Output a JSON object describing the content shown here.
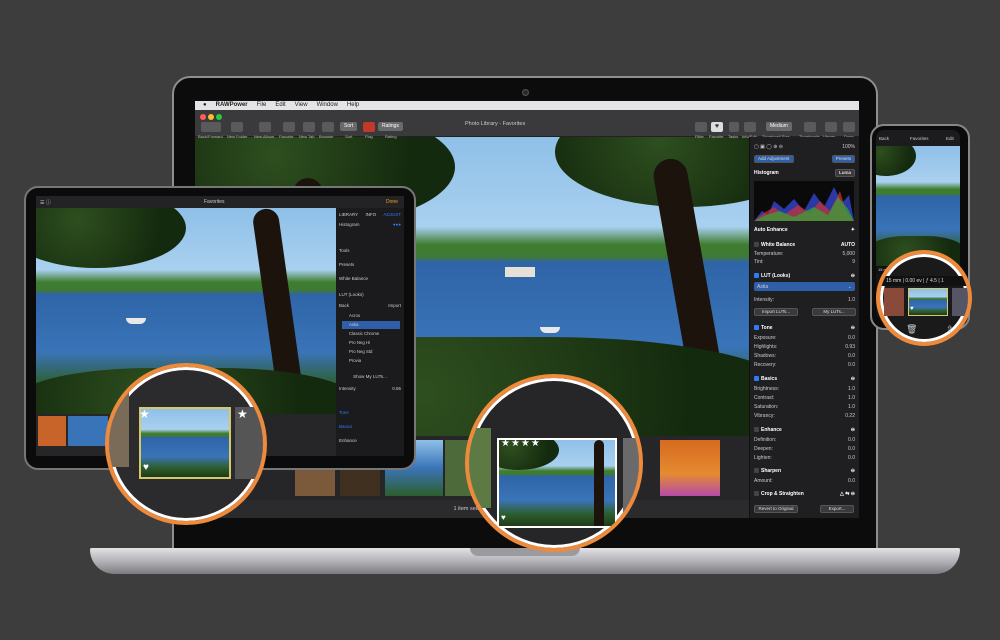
{
  "menu": {
    "apple": "",
    "app": "RAWPower",
    "file": "File",
    "edit": "Edit",
    "view": "View",
    "window": "Window",
    "help": "Help"
  },
  "window_title": "Photo Library - Favorites",
  "toolbar": {
    "back_forward": "Back/Forward",
    "new_folder": "New Folder",
    "new_album": "New Album",
    "favorite": "Favorite",
    "new_tab": "New Tab",
    "browser": "Browser",
    "sort": "Sort",
    "sort_btn": "Sort",
    "flag": "Flag",
    "rating": "Rating",
    "ratings_btn": "Ratings",
    "filter": "Filter",
    "favorite_r": "Favorite",
    "tasks": "Tasks",
    "info_edit": "Info/Edit",
    "thumb_size": "Thumbnail Size",
    "medium": "Medium",
    "thumbnails": "Thumbnails",
    "viewer": "Viewer",
    "done": "Done"
  },
  "sidebar": {
    "zoom": "100%",
    "add_adjustment": "Add Adjustment",
    "presets": "Presets",
    "histogram": "Histogram",
    "luma": "Luma",
    "auto_enhance": "Auto Enhance",
    "white_balance": "White Balance",
    "auto": "AUTO",
    "temperature": "Temperature:",
    "temperature_val": "5,000",
    "tint": "Tint:",
    "tint_val": "9",
    "lut": "LUT (Looks)",
    "lut_selected": "Astia",
    "intensity": "Intensity:",
    "intensity_val": "1.0",
    "import_luts": "Import LUTs...",
    "my_luts": "My LUTs...",
    "tone": "Tone",
    "exposure": "Exposure:",
    "exposure_val": "0.0",
    "highlights": "Highlights:",
    "highlights_val": "0.93",
    "shadows": "Shadows:",
    "shadows_val": "0.0",
    "recovery": "Recovery:",
    "recovery_val": "0.0",
    "basics": "Basics",
    "brightness": "Brightness:",
    "brightness_val": "1.0",
    "contrast": "Contrast:",
    "contrast_val": "1.0",
    "saturation": "Saturation:",
    "saturation_val": "1.0",
    "vibrancy": "Vibrancy:",
    "vibrancy_val": "0.22",
    "enhance": "Enhance",
    "definition": "Definition:",
    "definition_val": "0.0",
    "deepen": "Deepen:",
    "deepen_val": "0.0",
    "lighten": "Lighten:",
    "lighten_val": "0.0",
    "sharpen": "Sharpen",
    "amount": "Amount:",
    "amount_val": "0.0",
    "crop": "Crop & Straighten",
    "revert": "Revert to Original",
    "export": "Export..."
  },
  "status_text": "1 item selected",
  "tablet": {
    "title": "Favorites",
    "done": "Done",
    "tabs": [
      "LIBRARY",
      "INFO",
      "ADJUST"
    ],
    "histogram": "Histogram",
    "tools": "Tools",
    "presets": "Presets",
    "white_balance": "White Balance",
    "lut": "LUT (Looks)",
    "back": "Back",
    "import": "Import",
    "luts": [
      "Acros",
      "Astia",
      "Classic Chrome",
      "Pro Neg Hi",
      "Pro Neg Std",
      "Provia"
    ],
    "show_my_luts": "Show My LUTs...",
    "intensity": "Intensity",
    "intensity_val": "0.65",
    "tone": "Tone",
    "basics": "Basics",
    "enhance": "Enhance"
  },
  "phone": {
    "back": "Back",
    "title": "Favorites",
    "edit": "Edit",
    "exif": "15 mm | 0.00 ev | ƒ 4.5 | 1"
  },
  "magnifier_center": {
    "stars": "★★★★"
  },
  "colors": {
    "accent": "#ee8a3c",
    "blue": "#2f7bf6"
  }
}
